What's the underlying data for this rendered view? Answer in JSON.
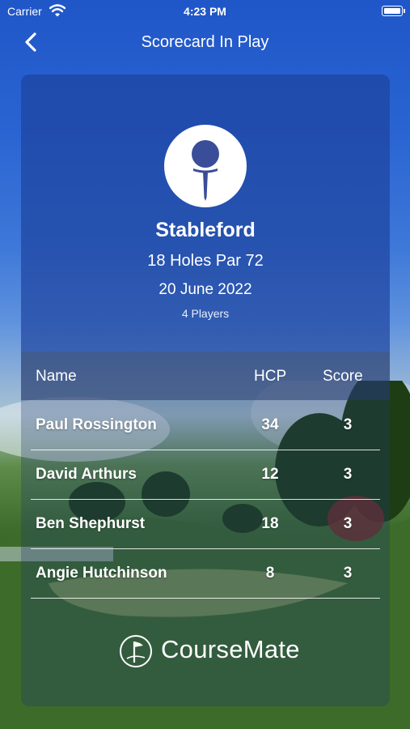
{
  "status": {
    "carrier": "Carrier",
    "time": "4:23 PM"
  },
  "nav": {
    "title": "Scorecard In Play"
  },
  "game": {
    "type": "Stableford",
    "course": "18 Holes Par 72",
    "date": "20 June 2022",
    "players": "4 Players"
  },
  "table": {
    "headers": {
      "name": "Name",
      "hcp": "HCP",
      "score": "Score"
    },
    "rows": [
      {
        "name": "Paul Rossington",
        "hcp": "34",
        "score": "3"
      },
      {
        "name": "David Arthurs",
        "hcp": "12",
        "score": "3"
      },
      {
        "name": "Ben Shephurst",
        "hcp": "18",
        "score": "3"
      },
      {
        "name": "Angie Hutchinson",
        "hcp": "8",
        "score": "3"
      }
    ]
  },
  "brand": {
    "name": "CourseMate"
  },
  "icons": {
    "wifi": "wifi-icon",
    "battery": "battery-icon",
    "back": "chevron-left-icon",
    "tee": "golf-tee-icon",
    "brand_logo": "golf-flag-logo-icon"
  },
  "colors": {
    "card_top": "#2a4fb5",
    "accent_white": "#ffffff"
  }
}
